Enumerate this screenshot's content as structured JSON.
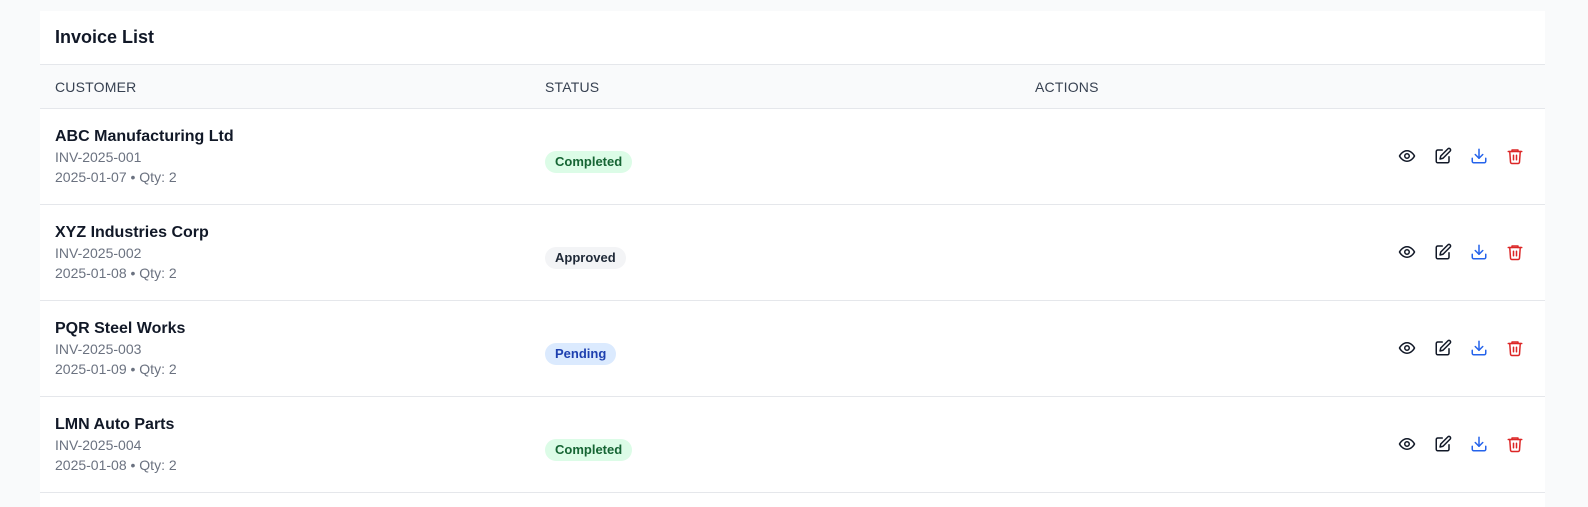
{
  "card": {
    "title": "Invoice List"
  },
  "table": {
    "headers": {
      "customer": "CUSTOMER",
      "status": "STATUS",
      "actions": "ACTIONS"
    },
    "rows": [
      {
        "customer": "ABC Manufacturing Ltd",
        "invoice": "INV-2025-001",
        "meta": "2025-01-07 • Qty: 2",
        "status": "Completed"
      },
      {
        "customer": "XYZ Industries Corp",
        "invoice": "INV-2025-002",
        "meta": "2025-01-08 • Qty: 2",
        "status": "Approved"
      },
      {
        "customer": "PQR Steel Works",
        "invoice": "INV-2025-003",
        "meta": "2025-01-09 • Qty: 2",
        "status": "Pending"
      },
      {
        "customer": "LMN Auto Parts",
        "invoice": "INV-2025-004",
        "meta": "2025-01-08 • Qty: 2",
        "status": "Completed"
      }
    ]
  },
  "icons": {
    "view": "eye-icon",
    "edit": "edit-icon",
    "download": "download-icon",
    "delete": "trash-icon"
  },
  "colors": {
    "completed_bg": "#dcfce7",
    "completed_text": "#166534",
    "approved_bg": "#f3f4f6",
    "approved_text": "#1f2937",
    "pending_bg": "#dbeafe",
    "pending_text": "#1e40af",
    "download": "#2563eb",
    "delete": "#dc2626"
  }
}
